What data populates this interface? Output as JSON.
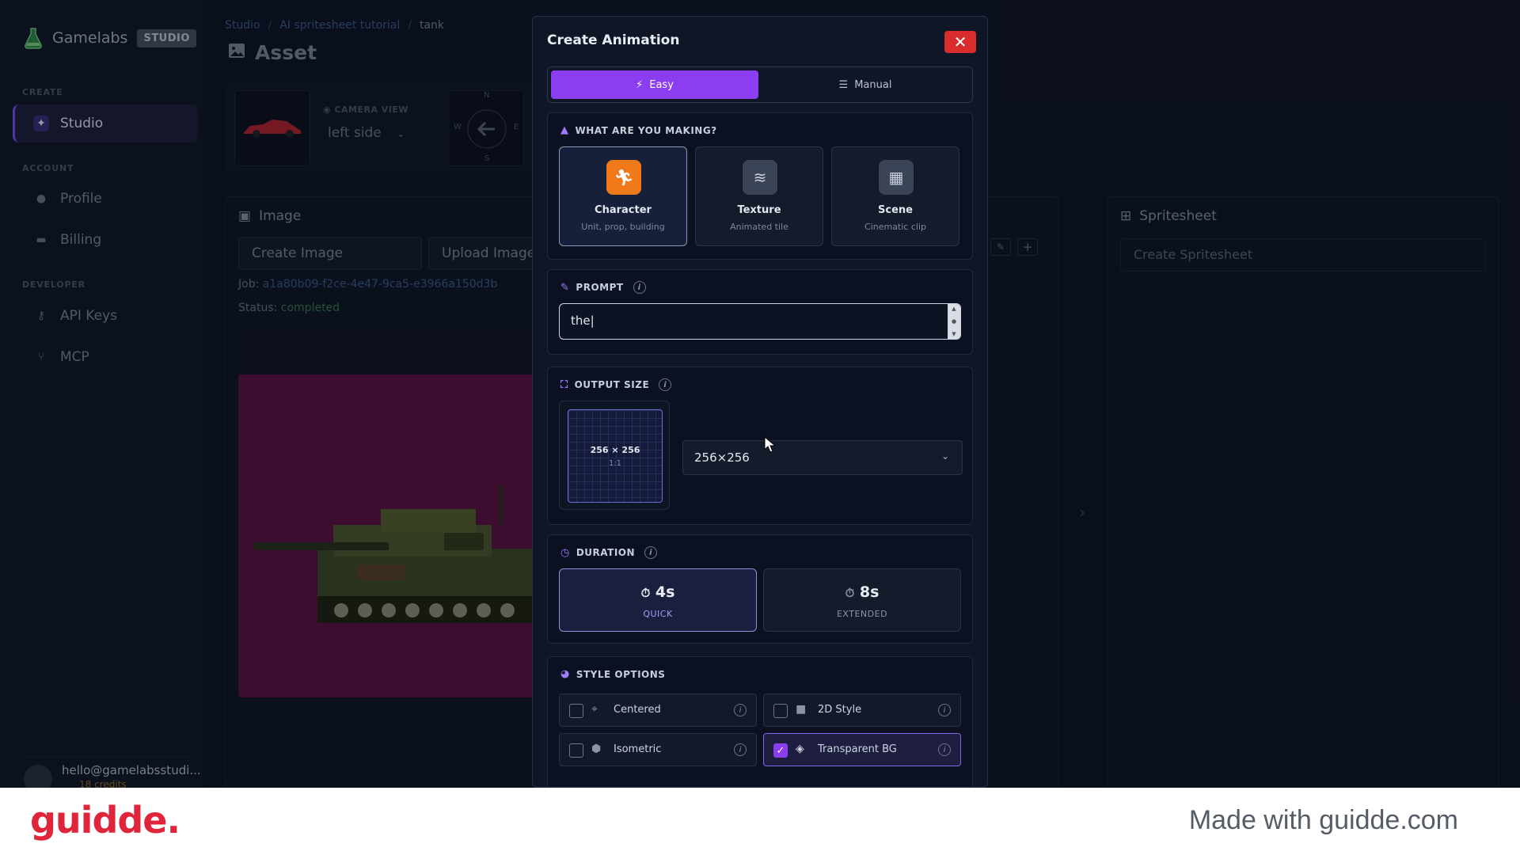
{
  "brand": {
    "name": "Gamelabs",
    "badge": "STUDIO"
  },
  "sidebar": {
    "sections": {
      "create": "CREATE",
      "account": "ACCOUNT",
      "developer": "DEVELOPER"
    },
    "items": {
      "studio": "Studio",
      "profile": "Profile",
      "billing": "Billing",
      "api_keys": "API Keys",
      "mcp": "MCP"
    },
    "user": {
      "email": "hello@gamelabsstudi...",
      "credits": "18 credits"
    }
  },
  "breadcrumb": {
    "root": "Studio",
    "project": "AI spritesheet tutorial",
    "current": "tank"
  },
  "page": {
    "title": "Asset"
  },
  "asset_strip": {
    "camera_label": "CAMERA VIEW",
    "camera_value": "left side",
    "compass": {
      "n": "N",
      "s": "S",
      "e": "E",
      "w": "W"
    }
  },
  "image_panel": {
    "title": "Image",
    "create_button": "Create Image",
    "upload_button": "Upload Image",
    "job_label": "Job:",
    "job_id": "a1a80b09-f2ce-4e47-9ca5-e3966a150d3b",
    "status_label": "Status:",
    "status_value": "completed"
  },
  "spritesheet_panel": {
    "title": "Spritesheet",
    "create_button": "Create Spritesheet"
  },
  "modal": {
    "title": "Create Animation",
    "close": "✕",
    "modes": {
      "easy": "Easy",
      "manual": "Manual",
      "selected": "Easy"
    },
    "making": {
      "heading": "WHAT ARE YOU MAKING?",
      "options": [
        {
          "name": "Character",
          "sub": "Unit, prop, building",
          "icon": "running-figure-icon",
          "selected": true
        },
        {
          "name": "Texture",
          "sub": "Animated tile",
          "icon": "waves-icon",
          "selected": false
        },
        {
          "name": "Scene",
          "sub": "Cinematic clip",
          "icon": "film-icon",
          "selected": false
        }
      ]
    },
    "prompt": {
      "heading": "PROMPT",
      "value": "the"
    },
    "output_size": {
      "heading": "OUTPUT SIZE",
      "preview_label": "256 × 256",
      "preview_ratio": "1:1",
      "selected": "256×256"
    },
    "duration": {
      "heading": "DURATION",
      "options": [
        {
          "value": "4s",
          "sub": "QUICK",
          "selected": true
        },
        {
          "value": "8s",
          "sub": "EXTENDED",
          "selected": false
        }
      ]
    },
    "style_options": {
      "heading": "STYLE OPTIONS",
      "options": [
        {
          "label": "Centered",
          "checked": false,
          "icon": "crosshair-icon"
        },
        {
          "label": "2D Style",
          "checked": false,
          "icon": "square-icon"
        },
        {
          "label": "Isometric",
          "checked": false,
          "icon": "cube-icon"
        },
        {
          "label": "Transparent BG",
          "checked": true,
          "icon": "eraser-icon"
        }
      ]
    }
  },
  "footer": {
    "logo": "guidde.",
    "text": "Made with guidde.com"
  },
  "colors": {
    "accent": "#8b3df0",
    "close": "#d92d2d",
    "character": "#f07a1a",
    "footer_logo": "#e0243a"
  }
}
